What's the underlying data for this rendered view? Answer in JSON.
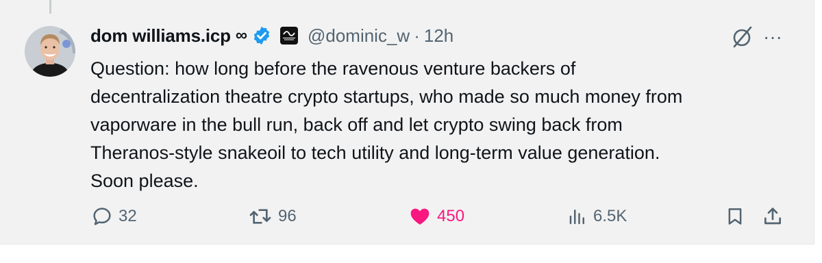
{
  "tweet": {
    "author": {
      "display_name": "dom williams.icp",
      "name_suffix": "∞",
      "verified": true,
      "verified_color": "#1d9bf0",
      "affiliate_badge": "internet-computer-logo",
      "handle": "@dominic_w",
      "separator": "·",
      "time": "12h"
    },
    "text_lines": [
      "Question: how long before the ravenous venture backers of",
      "decentralization theatre crypto startups, who made so much money from",
      "vaporware in the bull run, back off and let crypto swing back from",
      "Theranos-style snakeoil to tech utility and long-term value generation.",
      "Soon please."
    ],
    "top_right_icons": [
      "grok-icon",
      "more-icon"
    ],
    "more_glyph": "···",
    "actions": {
      "reply": {
        "icon": "reply-icon",
        "count": "32"
      },
      "repost": {
        "icon": "repost-icon",
        "count": "96"
      },
      "like": {
        "icon": "heart-icon",
        "count": "450",
        "liked": true,
        "color": "#f91880"
      },
      "views": {
        "icon": "views-icon",
        "count": "6.5K"
      },
      "bookmark": {
        "icon": "bookmark-icon"
      },
      "share": {
        "icon": "share-icon"
      }
    }
  }
}
